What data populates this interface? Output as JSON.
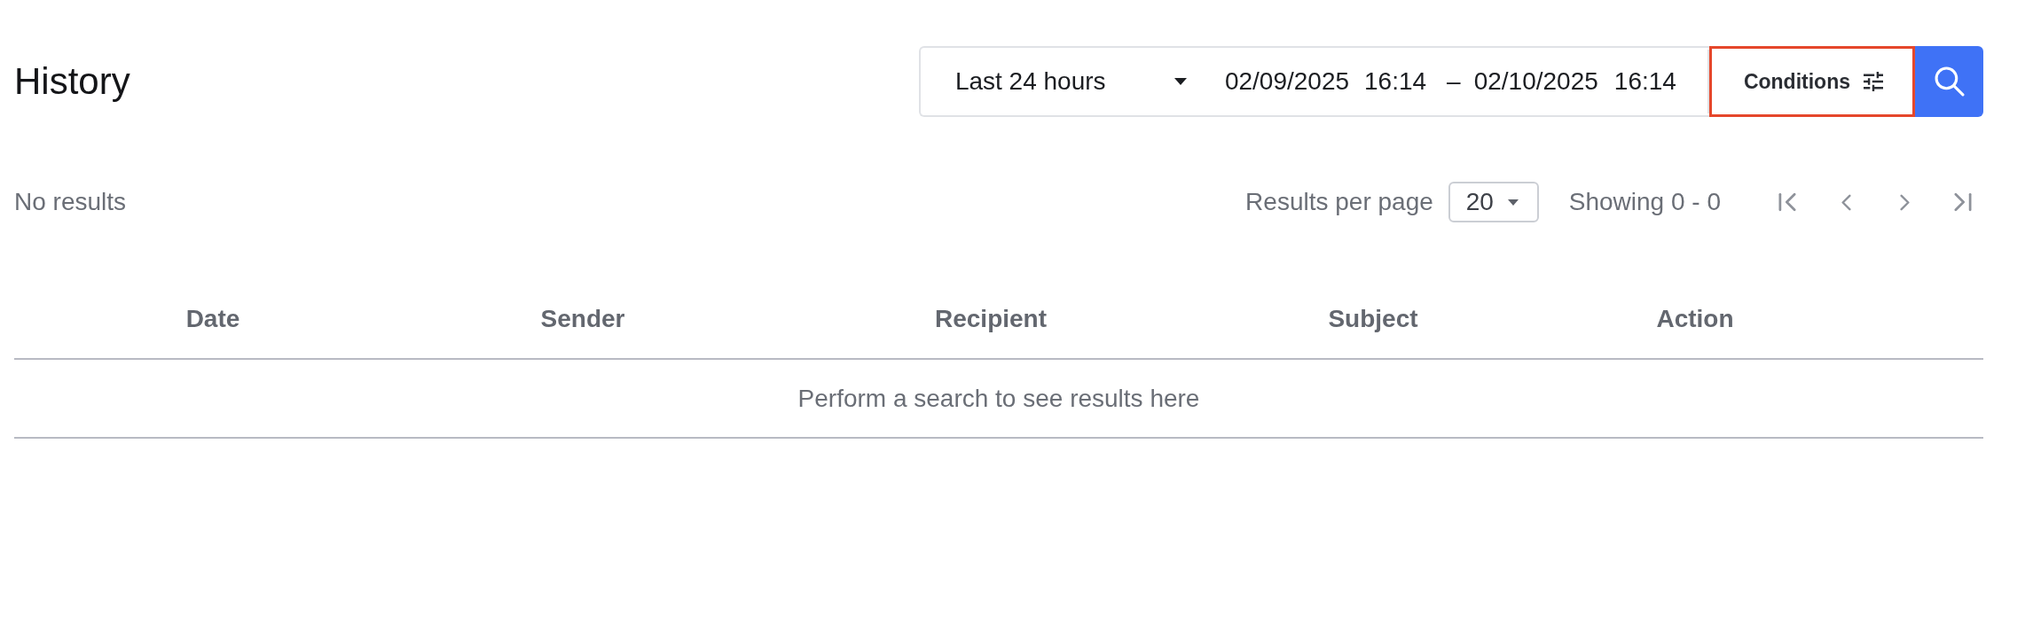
{
  "page": {
    "title": "History"
  },
  "filters": {
    "time_range": {
      "value": "Last 24 hours"
    },
    "date_range": {
      "start_date": "02/09/2025",
      "start_time": "16:14",
      "separator": "–",
      "end_date": "02/10/2025",
      "end_time": "16:14"
    },
    "conditions_button": {
      "label": "Conditions",
      "highlighted": true
    }
  },
  "results_summary": "No results",
  "pagination": {
    "per_page_label": "Results per page",
    "per_page": "20",
    "showing": "Showing 0 - 0",
    "buttons": [
      {
        "kind": "first",
        "disabled": true
      },
      {
        "kind": "previous",
        "disabled": true
      },
      {
        "kind": "next",
        "disabled": true
      },
      {
        "kind": "last",
        "disabled": true
      }
    ]
  },
  "table": {
    "columns": [
      "Date",
      "Sender",
      "Recipient",
      "Subject",
      "Action"
    ],
    "empty_message": "Perform a search to see results here"
  }
}
